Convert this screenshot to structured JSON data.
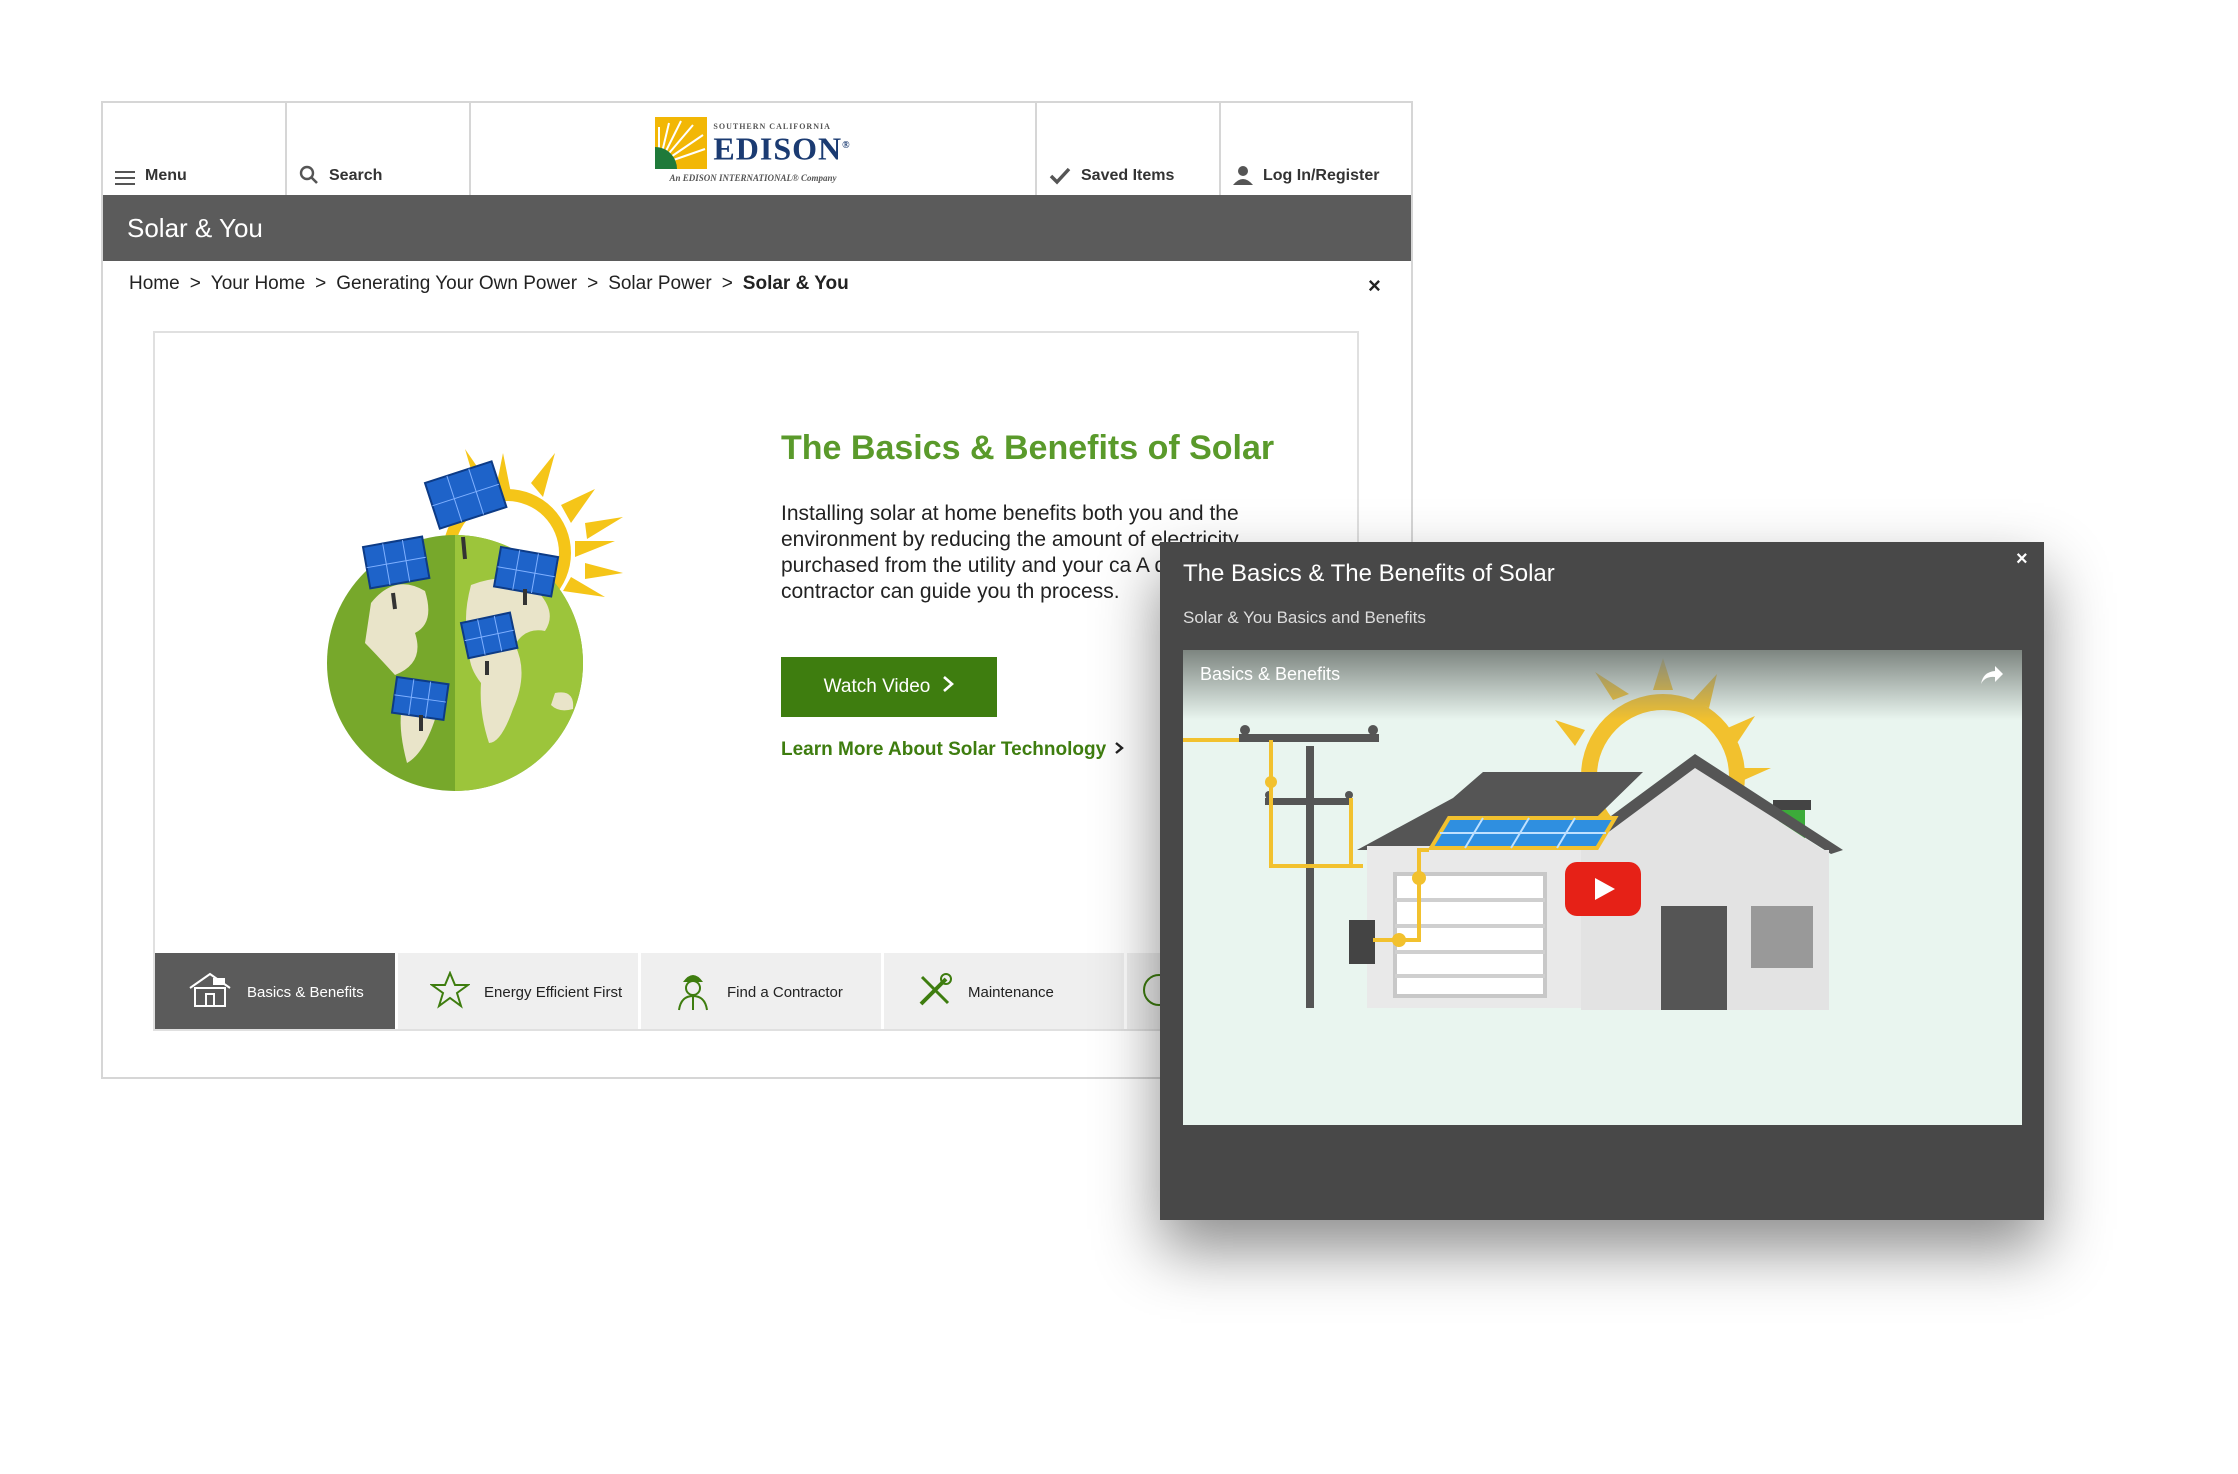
{
  "header": {
    "menu_label": "Menu",
    "search_label": "Search",
    "logo": {
      "small": "SOUTHERN CALIFORNIA",
      "name": "EDISON",
      "mark": "®",
      "tagline": "An EDISON INTERNATIONAL® Company"
    },
    "saved_label": "Saved Items",
    "login_label": "Log In/Register"
  },
  "page_title": "Solar & You",
  "breadcrumb": [
    "Home",
    "Your Home",
    "Generating Your Own Power",
    "Solar Power",
    "Solar & You"
  ],
  "breadcrumb_sep": ">",
  "close_glyph": "×",
  "hero": {
    "title": "The Basics & Benefits of Solar",
    "body": "Installing solar at home benefits both you and the environment by reducing the amount of electricity purchased from the utility and your ca A qualified contractor can guide you th process.",
    "watch_label": "Watch Video",
    "learn_label": "Learn More About Solar Technology"
  },
  "tabs": [
    {
      "label": "Basics & Benefits",
      "icon": "house-solar-icon",
      "active": true
    },
    {
      "label": "Energy Efficient First",
      "icon": "star-icon",
      "active": false
    },
    {
      "label": "Find a Contractor",
      "icon": "contractor-icon",
      "active": false
    },
    {
      "label": "Maintenance",
      "icon": "tools-icon",
      "active": false
    }
  ],
  "modal": {
    "title": "The Basics & The Benefits of Solar",
    "subtitle": "Solar & You Basics and Benefits",
    "video_title": "Basics & Benefits"
  },
  "colors": {
    "brand_green": "#3e7d0f",
    "title_green": "#5a9a2b",
    "header_gray": "#5b5b5b",
    "modal_gray": "#484848",
    "play_red": "#e62117"
  }
}
